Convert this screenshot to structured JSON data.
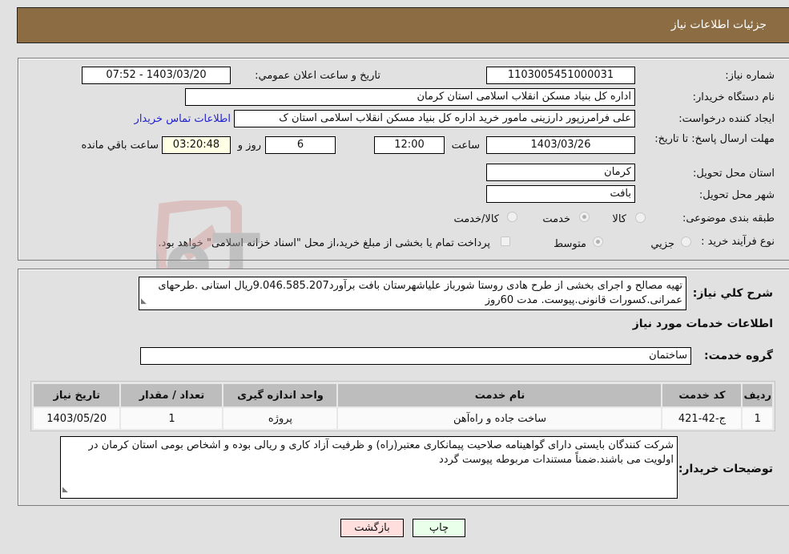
{
  "header": {
    "title": "جزئیات اطلاعات نیاز"
  },
  "form": {
    "need_number": {
      "label": "شماره نیاز:",
      "value": "1103005451000031"
    },
    "announce_datetime": {
      "label": "تاريخ و ساعت اعلان عمومي:",
      "value": "1403/03/20 - 07:52"
    },
    "buyer_org": {
      "label": "نام دستگاه خريدار:",
      "value": "اداره کل بنیاد مسکن انقلاب اسلامی استان کرمان"
    },
    "requester": {
      "label": "ایجاد کننده درخواست:",
      "value": "علی فرامرزپور دارزینی مامور خرید اداره کل بنیاد مسکن انقلاب اسلامی استان ک",
      "contact_link": "اطلاعات تماس خريدار"
    },
    "deadline": {
      "label": "مهلت ارسال پاسخ: تا تاريخ:",
      "date": "1403/03/26",
      "time_label": "ساعت",
      "time": "12:00",
      "days": "6",
      "days_label": "روز و",
      "remaining": "03:20:48",
      "remaining_label": "ساعت باقي مانده"
    },
    "province": {
      "label": "استان محل تحويل:",
      "value": "کرمان"
    },
    "city": {
      "label": "شهر محل تحويل:",
      "value": "بافت"
    },
    "category": {
      "label": "طبقه بندی موضوعی:",
      "options": [
        "کالا",
        "خدمت",
        "کالا/خدمت"
      ],
      "selected": "خدمت"
    },
    "purchase_type": {
      "label": "نوع فرآیند خرید :",
      "options": [
        "جزيي",
        "متوسط"
      ],
      "selected": "متوسط",
      "treasury_checkbox_label": "پرداخت تمام یا بخشی از مبلغ خرید،از محل \"اسناد خزانه اسلامی\" خواهد بود.",
      "treasury_checked": false
    }
  },
  "description": {
    "label": "شرح كلي نياز:",
    "value": "تهیه مصالح و اجرای بخشی از طرح هادی روستا شورباز علیاشهرستان بافت برآورد9.046.585.207ریال استانی .طرحهای عمرانی.کسورات قانونی.پیوست. مدت 60روز"
  },
  "services_section": {
    "title": "اطلاعات خدمات مورد نياز"
  },
  "service_group": {
    "label": "گروه خدمت:",
    "value": "ساختمان"
  },
  "table": {
    "headers": [
      "رديف",
      "کد خدمت",
      "نام خدمت",
      "واحد اندازه گيری",
      "تعداد / مقدار",
      "تاريخ نياز"
    ],
    "rows": [
      [
        "1",
        "ج-42-421",
        "ساخت جاده و راه‌آهن",
        "پروژه",
        "1",
        "1403/05/20"
      ]
    ]
  },
  "buyer_notes": {
    "label": "توضيحات خريدار:",
    "value": "شرکت کنندگان بایستی دارای گواهینامه صلاحیت پیمانکاری معتبر(راه) و ظرفیت آزاد کاری و ریالی بوده و اشخاص بومی استان کرمان در اولویت می باشند.ضمناً مستندات مربوطه پیوست گردد"
  },
  "buttons": {
    "print": "چاپ",
    "back": "بازگشت"
  },
  "watermark": {
    "text": "AriaTender.neT"
  },
  "colors": {
    "header_bg": "#8c6c42",
    "link": "#2222cc",
    "back_btn": "#ffdede",
    "print_btn": "#eaffea"
  }
}
